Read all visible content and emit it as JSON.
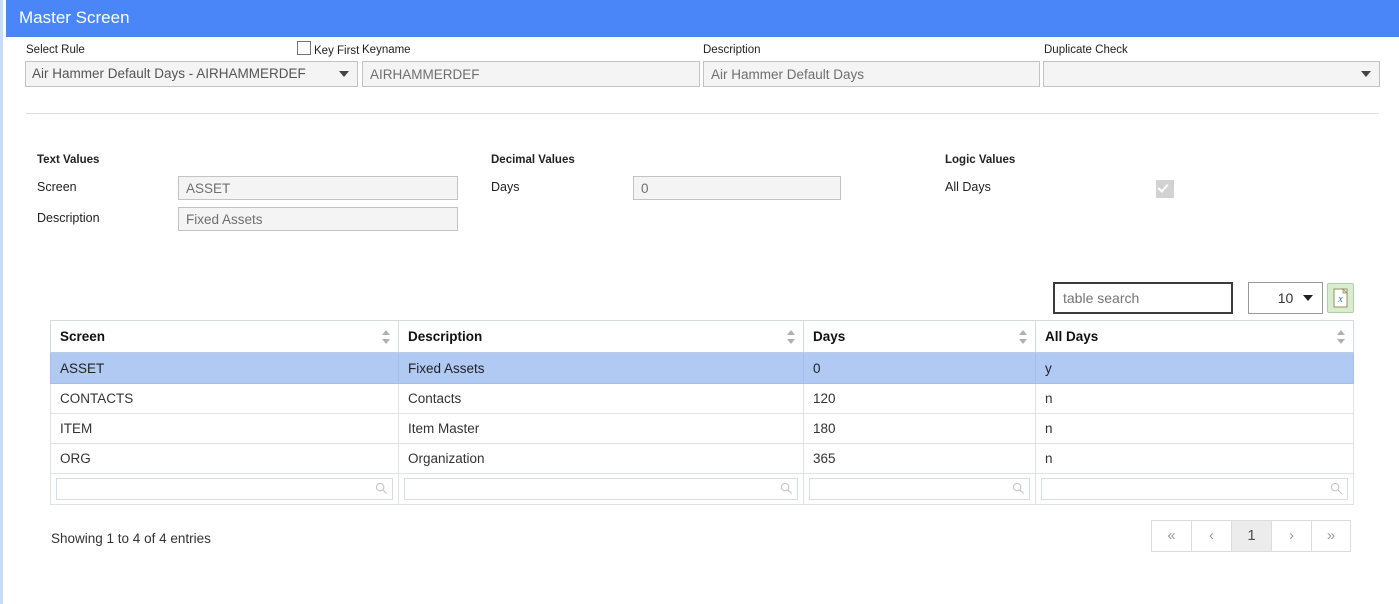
{
  "window": {
    "title": "Master Screen",
    "header_color": "#4a86f7"
  },
  "form": {
    "select_rule": {
      "label": "Select Rule",
      "value": "Air Hammer Default Days - AIRHAMMERDEF"
    },
    "key_first": {
      "label": "Key First",
      "checked": false
    },
    "keyname": {
      "label": "Keyname",
      "value": "AIRHAMMERDEF"
    },
    "description": {
      "label": "Description",
      "value": "Air Hammer Default Days"
    },
    "duplicate_check": {
      "label": "Duplicate Check",
      "value": ""
    }
  },
  "sections": {
    "text_values": {
      "heading": "Text Values",
      "screen": {
        "label": "Screen",
        "value": "ASSET"
      },
      "description": {
        "label": "Description",
        "value": "Fixed Assets"
      }
    },
    "decimal_values": {
      "heading": "Decimal Values",
      "days": {
        "label": "Days",
        "value": "0"
      }
    },
    "logic_values": {
      "heading": "Logic Values",
      "all_days": {
        "label": "All Days",
        "checked": true,
        "disabled": true
      }
    }
  },
  "table_controls": {
    "search_placeholder": "table search",
    "search_value": "",
    "page_length": "10",
    "export_icon": "excel-export-icon"
  },
  "table": {
    "columns": [
      "Screen",
      "Description",
      "Days",
      "All Days"
    ],
    "rows": [
      {
        "screen": "ASSET",
        "description": "Fixed Assets",
        "days": "0",
        "all_days": "y",
        "selected": true
      },
      {
        "screen": "CONTACTS",
        "description": "Contacts",
        "days": "120",
        "all_days": "n",
        "selected": false
      },
      {
        "screen": "ITEM",
        "description": "Item Master",
        "days": "180",
        "all_days": "n",
        "selected": false
      },
      {
        "screen": "ORG",
        "description": "Organization",
        "days": "365",
        "all_days": "n",
        "selected": false
      }
    ],
    "filters": [
      "",
      "",
      "",
      ""
    ],
    "selected_row_color": "#b0caf3"
  },
  "footer": {
    "showing": "Showing 1 to 4 of 4 entries",
    "pagination": [
      {
        "label": "«",
        "name": "first",
        "active": false
      },
      {
        "label": "‹",
        "name": "previous",
        "active": false
      },
      {
        "label": "1",
        "name": "page-1",
        "active": true
      },
      {
        "label": "›",
        "name": "next",
        "active": false
      },
      {
        "label": "»",
        "name": "last",
        "active": false
      }
    ]
  }
}
